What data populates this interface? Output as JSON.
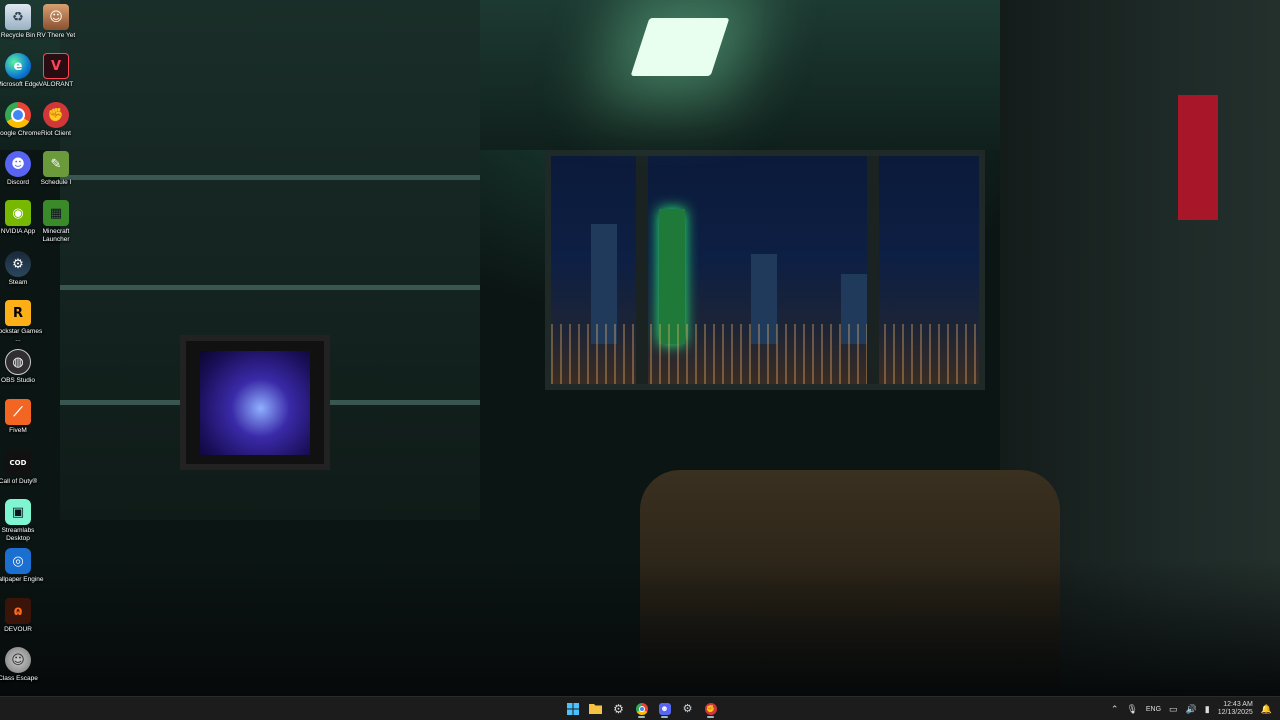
{
  "desktop": {
    "icons": [
      {
        "label": "Recycle Bin",
        "icon": "recycle-bin-icon"
      },
      {
        "label": "RV There Yet",
        "icon": "rv-there-yet-icon"
      },
      {
        "label": "Microsoft Edge",
        "icon": "edge-icon"
      },
      {
        "label": "VALORANT",
        "icon": "valorant-icon"
      },
      {
        "label": "Google Chrome",
        "icon": "chrome-icon"
      },
      {
        "label": "Riot Client",
        "icon": "riot-client-icon"
      },
      {
        "label": "Discord",
        "icon": "discord-icon"
      },
      {
        "label": "Schedule I",
        "icon": "schedule-i-icon"
      },
      {
        "label": "NVIDIA App",
        "icon": "nvidia-icon"
      },
      {
        "label": "Minecraft Launcher",
        "icon": "minecraft-icon"
      },
      {
        "label": "Steam",
        "icon": "steam-icon"
      },
      {
        "label": "Rockstar Games ...",
        "icon": "rockstar-icon"
      },
      {
        "label": "OBS Studio",
        "icon": "obs-icon"
      },
      {
        "label": "FiveM",
        "icon": "fivem-icon"
      },
      {
        "label": "Call of Duty®",
        "icon": "call-of-duty-icon"
      },
      {
        "label": "Streamlabs Desktop",
        "icon": "streamlabs-icon"
      },
      {
        "label": "Wallpaper Engine",
        "icon": "wallpaper-engine-icon"
      },
      {
        "label": "DEVOUR",
        "icon": "devour-icon"
      },
      {
        "label": "Class Escape",
        "icon": "class-escape-icon"
      }
    ]
  },
  "taskbar": {
    "pinned": [
      {
        "name": "start",
        "icon": "windows-start-icon"
      },
      {
        "name": "file-explorer",
        "icon": "folder-icon"
      },
      {
        "name": "settings",
        "icon": "gear-icon"
      },
      {
        "name": "chrome",
        "icon": "chrome-icon"
      },
      {
        "name": "discord",
        "icon": "discord-icon"
      },
      {
        "name": "steam",
        "icon": "steam-icon"
      },
      {
        "name": "riot-client",
        "icon": "riot-client-icon"
      }
    ],
    "tray": {
      "language": "ENG",
      "time": "12:43 AM",
      "date": "12/13/2025"
    }
  },
  "colors": {
    "taskbar_bg": "#1c1c1c",
    "accent": "#0078d4"
  }
}
